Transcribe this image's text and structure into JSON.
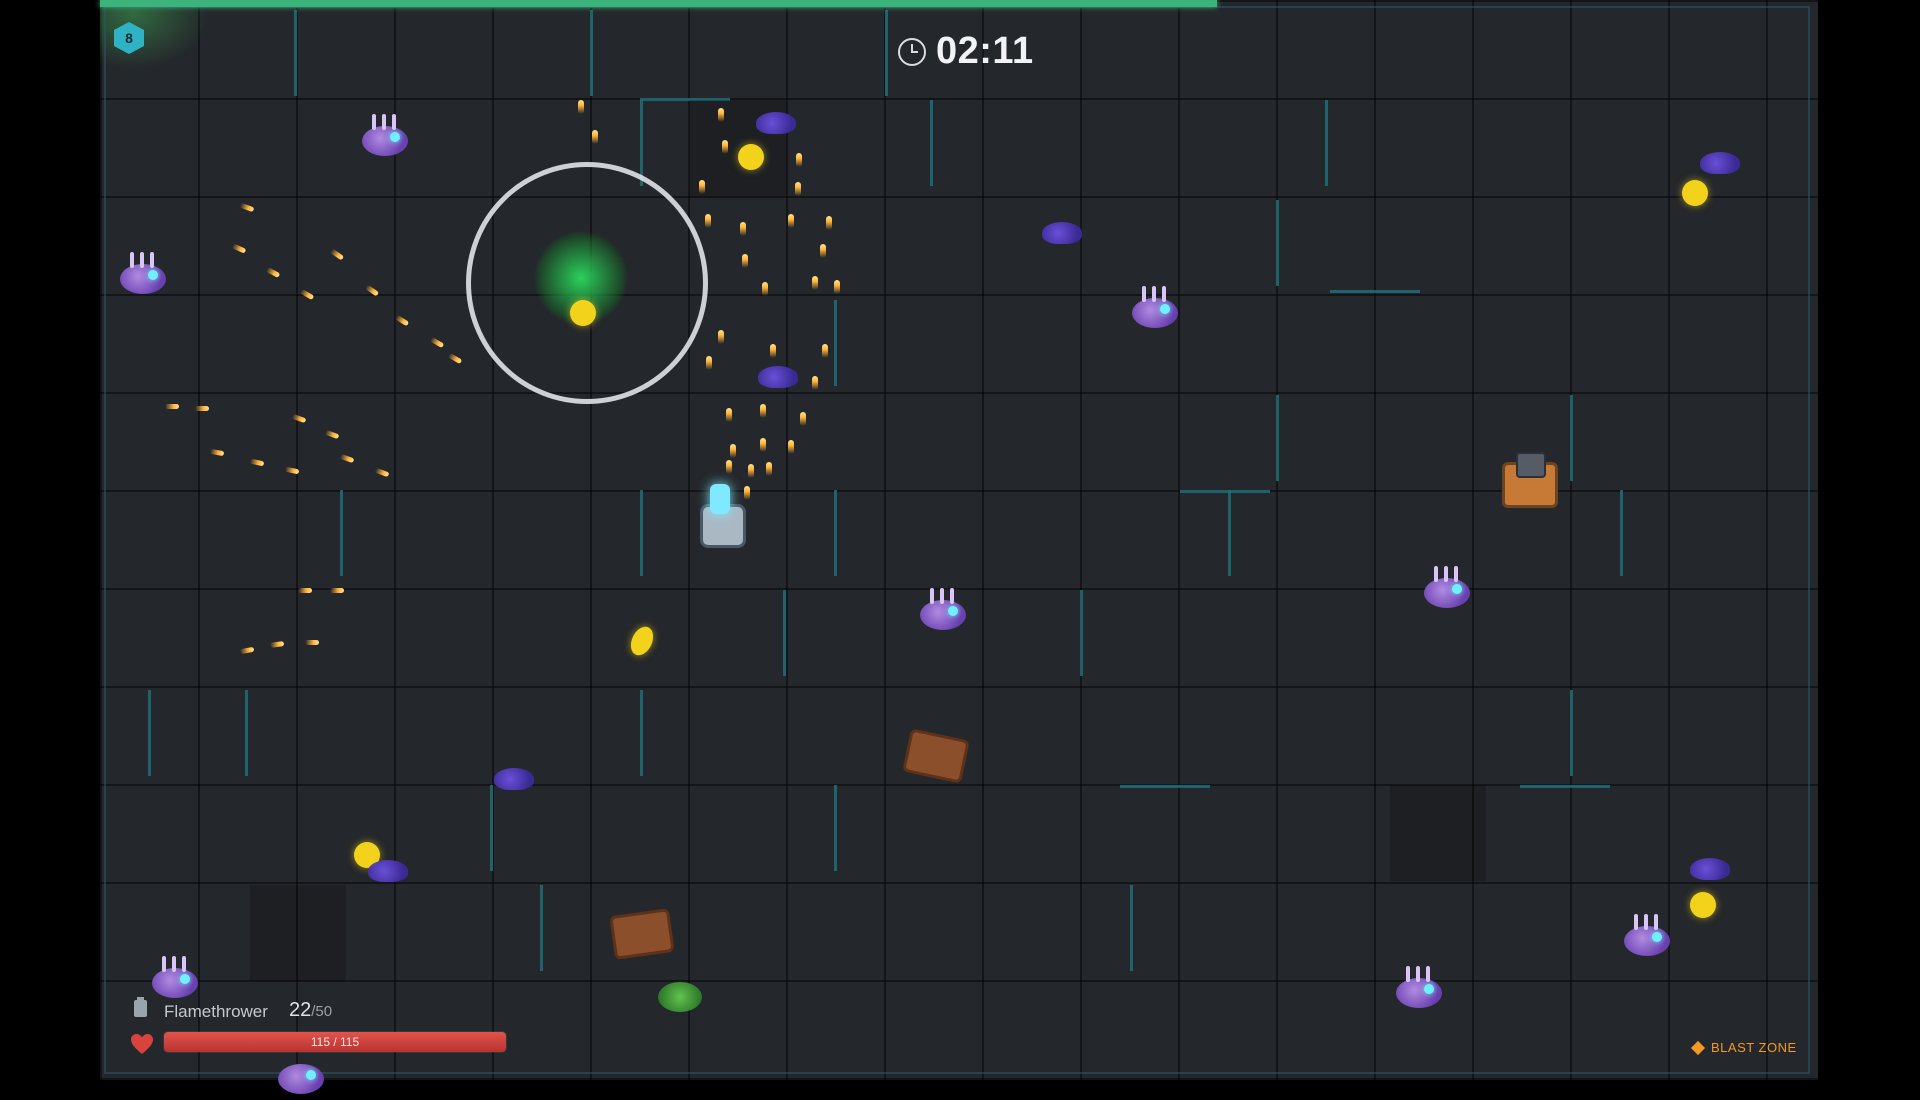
{
  "hud": {
    "level": "8",
    "timer": "02:11",
    "weapon_name": "Flamethrower",
    "ammo_current": "22",
    "ammo_max": "/50",
    "health_text": "115 / 115",
    "health_fraction": 1.0,
    "zone_label": "BLAST ZONE",
    "progress_fraction": 0.65
  },
  "icons": {
    "level": "hexagon-level-icon",
    "timer": "clock-icon",
    "ammo": "ammo-clip-icon",
    "health": "heart-icon",
    "zone": "diamond-icon"
  },
  "colors": {
    "progress": "#3bb37a",
    "health": "#d9433d",
    "zone": "#f29a23",
    "level_badge": "#2fb3c4"
  }
}
